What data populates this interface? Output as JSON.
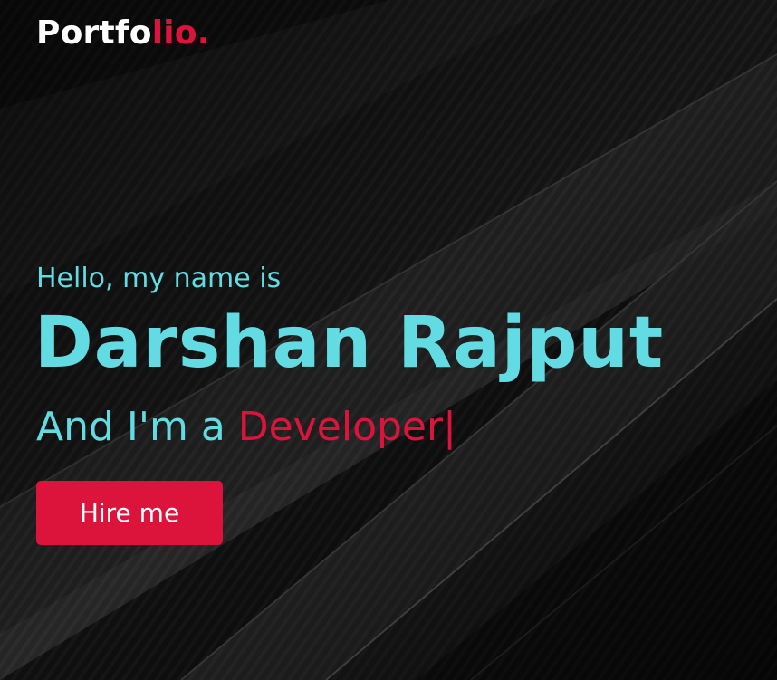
{
  "logo": {
    "main": "Portfo",
    "accent": "lio."
  },
  "hero": {
    "greeting": "Hello, my name is",
    "name": "Darshan Rajput",
    "role_prefix": "And I'm a ",
    "role": "Developer",
    "cursor": "|",
    "cta_label": "Hire me"
  },
  "colors": {
    "accent": "#dc143c",
    "primary_text": "#62dbe3",
    "logo_text": "#ffffff",
    "background": "#0e0e0e"
  }
}
